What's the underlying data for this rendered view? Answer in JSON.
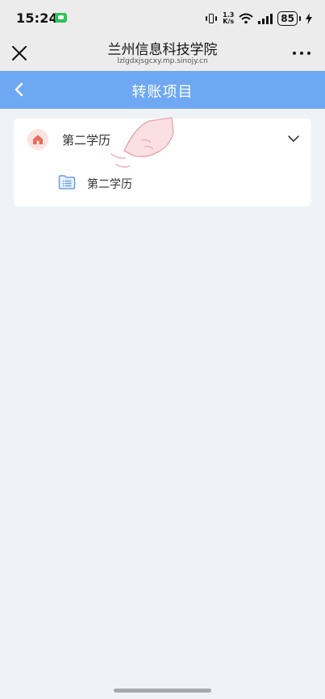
{
  "status_bar": {
    "time": "15:24",
    "net_speed_value": "1.3",
    "net_speed_unit": "K/s",
    "battery": "85"
  },
  "title_bar": {
    "title": "兰州信息科技学院",
    "domain": "lzlgdxjsgcxy.mp.sinojy.cn"
  },
  "nav_bar": {
    "title": "转账项目"
  },
  "project_group": {
    "label": "第二学历",
    "expanded": true,
    "items": [
      {
        "label": "第二学历"
      }
    ]
  },
  "colors": {
    "nav_blue": "#6fa8f2",
    "page_bg": "#eff3f7",
    "home_icon_red": "#e86a5c",
    "folder_blue": "#6a9fe0"
  },
  "icons": [
    "close-icon",
    "more-icon",
    "back-arrow-icon",
    "home-icon",
    "chevron-down-icon",
    "folder-list-icon",
    "tap-hand-icon"
  ]
}
